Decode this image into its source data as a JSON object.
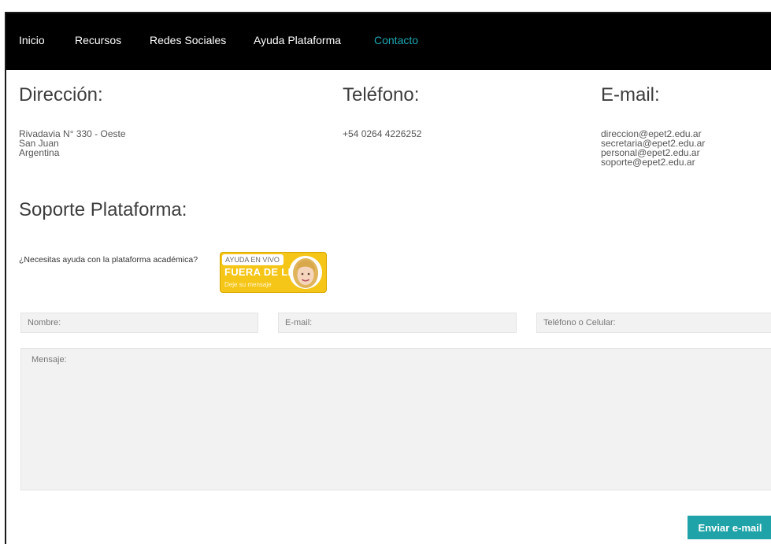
{
  "nav": {
    "items": [
      {
        "label": "Inicio"
      },
      {
        "label": "Recursos"
      },
      {
        "label": "Redes Sociales"
      },
      {
        "label": "Ayuda Plataforma"
      },
      {
        "label": "Contacto"
      }
    ],
    "active_color": "#1fa7b3"
  },
  "address": {
    "heading": "Dirección:",
    "lines": [
      "Rivadavia N° 330 - Oeste",
      "San Juan",
      "Argentina"
    ]
  },
  "phone": {
    "heading": "Teléfono:",
    "lines": [
      "+54 0264 4226252"
    ]
  },
  "email": {
    "heading": "E-mail:",
    "lines": [
      "direccion@epet2.edu.ar",
      "secretaria@epet2.edu.ar",
      "personal@epet2.edu.ar",
      "soporte@epet2.edu.ar"
    ]
  },
  "support": {
    "heading": "Soporte Plataforma:",
    "help_text": "¿Necesitas ayuda con la plataforma académica?",
    "badge": {
      "top": "AYUDA EN VIVO",
      "main": "FUERA DE LINEA",
      "sub": "Deje su mensaje"
    }
  },
  "form": {
    "name_placeholder": "Nombre:",
    "email_placeholder": "E-mail:",
    "phone_placeholder": "Teléfono o Celular:",
    "message_placeholder": "Mensaje:",
    "submit_label": "Enviar e-mail"
  },
  "colors": {
    "navbar_bg": "#000000",
    "accent": "#1fa3a8",
    "badge_yellow": "#f5c518",
    "field_bg": "#f2f2f2"
  }
}
